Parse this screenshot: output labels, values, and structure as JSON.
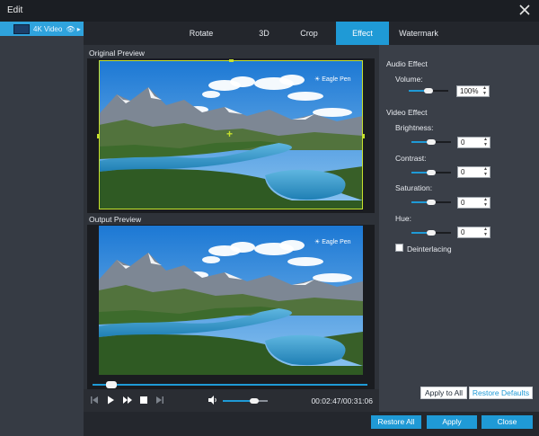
{
  "window": {
    "title": "Edit"
  },
  "sidebar": {
    "file": {
      "name": "4K Video",
      "icons_text": "👁 ▸"
    }
  },
  "tabs": [
    {
      "label": "Rotate",
      "active": false
    },
    {
      "label": "3D",
      "active": false
    },
    {
      "label": "Crop",
      "active": false
    },
    {
      "label": "Effect",
      "active": true
    },
    {
      "label": "Watermark",
      "active": false
    }
  ],
  "preview": {
    "original_label": "Original Preview",
    "output_label": "Output Preview",
    "watermark_text": "☀ Eagle Pen"
  },
  "player": {
    "progress": 0.07,
    "volume": 0.7,
    "time_current": "00:02:47",
    "time_total": "00:31:06",
    "time_separator": "/"
  },
  "audio_effect": {
    "title": "Audio Effect",
    "volume_label": "Volume:",
    "volume_value": "100%",
    "volume_level": 0.5
  },
  "video_effect": {
    "title": "Video Effect",
    "brightness_label": "Brightness:",
    "brightness_value": "0",
    "contrast_label": "Contrast:",
    "contrast_value": "0",
    "saturation_label": "Saturation:",
    "saturation_value": "0",
    "hue_label": "Hue:",
    "hue_value": "0",
    "deinterlacing_label": "Deinterlacing",
    "deinterlacing_checked": false,
    "level": 0.5
  },
  "buttons": {
    "apply_to_all": "Apply to All",
    "restore_defaults": "Restore Defaults",
    "restore_all": "Restore All",
    "apply": "Apply",
    "close": "Close"
  },
  "colors": {
    "accent": "#1f9ad6",
    "crop_border": "#c7e12d",
    "panel": "#3a3f48",
    "titlebar": "#1b1e23"
  },
  "icons": {
    "close": "close-icon",
    "skip_back": "skip-back-icon",
    "play": "play-icon",
    "fast_forward": "fast-forward-icon",
    "stop": "stop-icon",
    "skip_end": "skip-end-icon",
    "volume": "volume-icon"
  }
}
